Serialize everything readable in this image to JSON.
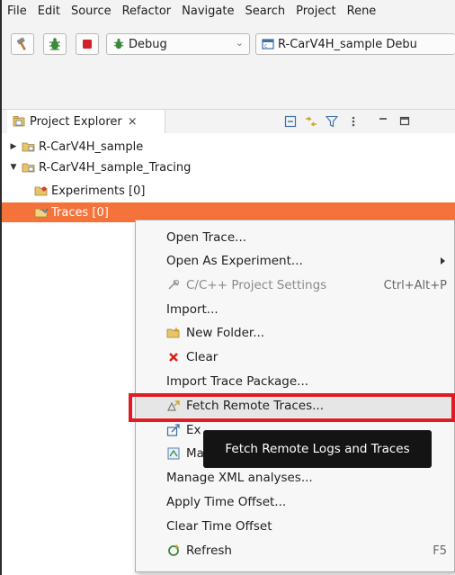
{
  "menubar": {
    "items": [
      "File",
      "Edit",
      "Source",
      "Refactor",
      "Navigate",
      "Search",
      "Project",
      "Rene"
    ]
  },
  "toolbar": {
    "build_icon": "hammer-icon",
    "debug_bug_icon": "bug-icon",
    "stop_icon": "stop-icon",
    "launch_mode": "Debug",
    "launch_config": "R-CarV4H_sample Debu"
  },
  "project_explorer": {
    "title": "Project Explorer",
    "close_glyph": "×",
    "header_icons": [
      "collapse-all-icon",
      "link-editor-icon",
      "filter-icon",
      "view-menu-icon",
      "minimize-icon",
      "maximize-icon"
    ]
  },
  "tree": {
    "items": [
      {
        "label": "R-CarV4H_sample",
        "expanded": false
      },
      {
        "label": "R-CarV4H_sample_Tracing",
        "expanded": true
      },
      {
        "label": "Experiments [0]"
      },
      {
        "label": "Traces [0]",
        "selected": true
      }
    ]
  },
  "context_menu": {
    "open_trace": "Open Trace...",
    "open_as_experiment": "Open As Experiment...",
    "cpp_settings": "C/C++ Project Settings",
    "cpp_settings_shortcut": "Ctrl+Alt+P",
    "import": "Import...",
    "new_folder": "New Folder...",
    "clear": "Clear",
    "import_trace_package": "Import Trace Package...",
    "fetch_remote": "Fetch Remote Traces...",
    "export_partial": "Ex",
    "manage_partial": "Ma",
    "manage_xml": "Manage XML analyses...",
    "apply_time_offset": "Apply Time Offset...",
    "clear_time_offset": "Clear Time Offset",
    "refresh": "Refresh",
    "refresh_shortcut": "F5"
  },
  "tooltip": {
    "text": "Fetch Remote Logs and Traces"
  },
  "colors": {
    "selection": "#f5733a",
    "highlight_box": "#e01b24",
    "tooltip_bg": "#141414"
  }
}
